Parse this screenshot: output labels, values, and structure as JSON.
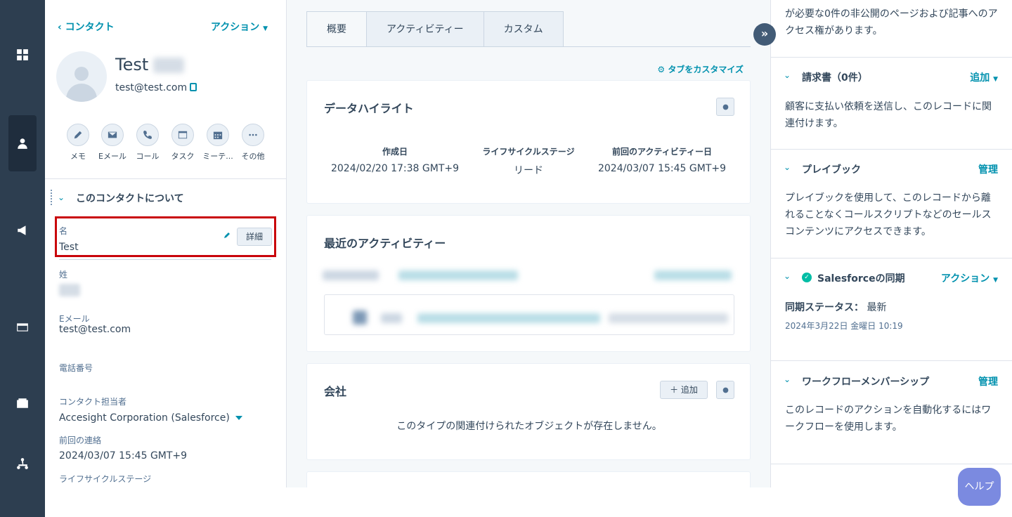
{
  "nav": {
    "items": [
      "dashboard-icon",
      "contacts-icon",
      "marketing-icon",
      "sales-icon",
      "wallet-icon",
      "org-icon"
    ]
  },
  "left": {
    "back_label": "コンタクト",
    "actions_label": "アクション",
    "contact_name": "Test",
    "contact_email": "test@test.com",
    "quick_actions": [
      {
        "label": "メモ",
        "icon": "edit-icon"
      },
      {
        "label": "Eメール",
        "icon": "mail-icon"
      },
      {
        "label": "コール",
        "icon": "phone-icon"
      },
      {
        "label": "タスク",
        "icon": "task-icon"
      },
      {
        "label": "ミーテ...",
        "icon": "calendar-icon"
      },
      {
        "label": "その他",
        "icon": "more-icon"
      }
    ],
    "section_title": "このコンタクトについて",
    "details_button": "詳細",
    "properties": {
      "first_name_label": "名",
      "first_name_value": "Test",
      "last_name_label": "姓",
      "email_label": "Eメール",
      "email_value": "test@test.com",
      "phone_label": "電話番号",
      "owner_label": "コンタクト担当者",
      "owner_value": "Accesight Corporation (Salesforce)",
      "last_contacted_label": "前回の連絡",
      "last_contacted_value": "2024/03/07 15:45 GMT+9",
      "lifecycle_label": "ライフサイクルステージ"
    }
  },
  "middle": {
    "tabs": [
      "概要",
      "アクティビティー",
      "カスタム"
    ],
    "customize_label": "タブをカスタマイズ",
    "highlights": {
      "title": "データハイライト",
      "items": [
        {
          "label": "作成日",
          "value": "2024/02/20 17:38 GMT+9"
        },
        {
          "label": "ライフサイクルステージ",
          "value": "リード"
        },
        {
          "label": "前回のアクティビティー日",
          "value": "2024/03/07 15:45 GMT+9"
        }
      ]
    },
    "recent_activity_title": "最近のアクティビティー",
    "company": {
      "title": "会社",
      "add_label": "＋ 追加",
      "empty_message": "このタイプの関連付けられたオブジェクトが存在しません。"
    }
  },
  "right": {
    "top_text": "が必要な0件の非公開のページおよび記事へのアクセス権があります。",
    "invoices": {
      "title": "請求書（0件）",
      "link": "追加",
      "text": "顧客に支払い依頼を送信し、このレコードに関連付けます。"
    },
    "playbook": {
      "title": "プレイブック",
      "link": "管理",
      "text": "プレイブックを使用して、このレコードから離れることなくコールスクリプトなどのセールスコンテンツにアクセスできます。"
    },
    "salesforce": {
      "title": "Salesforceの同期",
      "link": "アクション",
      "status_label": "同期ステータス：",
      "status_value": "最新",
      "timestamp": "2024年3月22日 金曜日 10:19"
    },
    "workflow": {
      "title": "ワークフローメンバーシップ",
      "link": "管理",
      "text": "このレコードのアクションを自動化するにはワークフローを使用します。"
    }
  },
  "help_label": "ヘルプ",
  "colors": {
    "accent": "#0091ae",
    "nav_bg": "#2d3e50",
    "highlight_border": "#c9050b",
    "help_bg": "#7b8ae0"
  }
}
